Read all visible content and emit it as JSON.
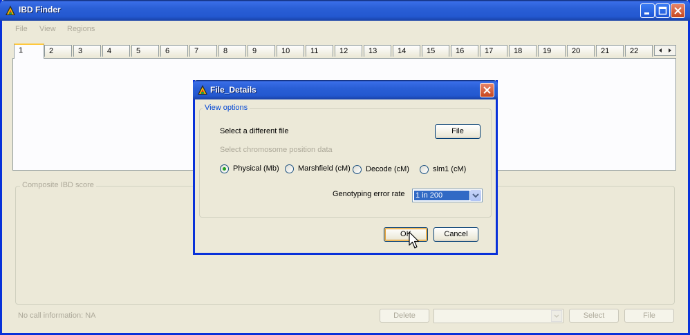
{
  "window": {
    "title": "IBD Finder"
  },
  "menu": [
    "File",
    "View",
    "Regions"
  ],
  "tabs": [
    "1",
    "2",
    "3",
    "4",
    "5",
    "6",
    "7",
    "8",
    "9",
    "10",
    "11",
    "12",
    "13",
    "14",
    "15",
    "16",
    "17",
    "18",
    "19",
    "20",
    "21",
    "22"
  ],
  "composite_group": {
    "label": "Composite IBD score"
  },
  "status": {
    "text": "No call information: NA"
  },
  "bottom_buttons": {
    "delete": "Delete",
    "select": "Select",
    "file": "File"
  },
  "dialog": {
    "title": "File_Details",
    "group_label": "View options",
    "select_file_label": "Select a different file",
    "file_button": "File",
    "chromosome_label": "Select chromosome position data",
    "radios": [
      {
        "label": "Physical (Mb)",
        "checked": true
      },
      {
        "label": "Marshfield (cM)",
        "checked": false
      },
      {
        "label": "Decode (cM)",
        "checked": false
      },
      {
        "label": "slm1 (cM)",
        "checked": false
      }
    ],
    "error_rate_label": "Genotyping error rate",
    "error_rate_value": "1 in 200",
    "ok_button": "OK",
    "cancel_button": "Cancel"
  },
  "colors": {
    "titlebar": "#2358d0",
    "face": "#ece9d8",
    "active_tab": "#ffc83c",
    "radio_dot": "#21a121"
  }
}
